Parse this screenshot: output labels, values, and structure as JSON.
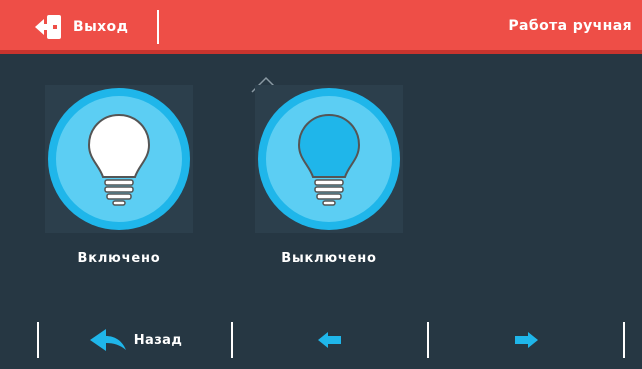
{
  "header": {
    "exit_label": "Выход",
    "mode_label": "Работа ручная"
  },
  "tiles": [
    {
      "label": "Включено",
      "icon": "bulb-on-icon",
      "state": "on"
    },
    {
      "label": "Выключено",
      "icon": "bulb-off-icon",
      "state": "off"
    }
  ],
  "footer": {
    "back_label": "Назад",
    "prev_icon": "arrow-left-icon",
    "next_icon": "arrow-right-icon"
  },
  "colors": {
    "header_bg": "#ee4e47",
    "body_bg": "#263743",
    "accent": "#1fb6ea",
    "accent_light": "#5ccef3"
  }
}
